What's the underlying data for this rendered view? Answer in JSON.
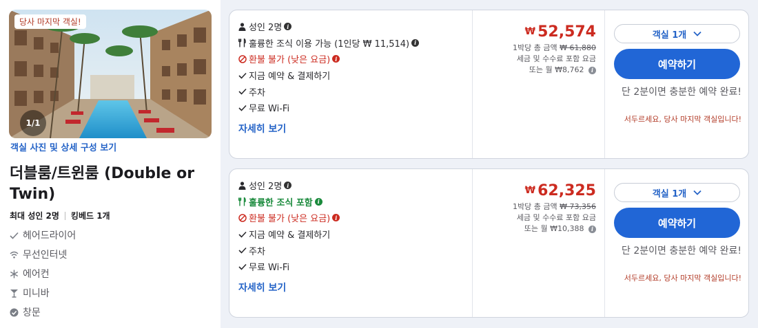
{
  "room": {
    "badge": "당사 마지막 객실!",
    "photo_counter": "1/1",
    "photo_link": "객실 사진 및 상세 구성 보기",
    "title": "더블룸/트윈룸 (Double or Twin)",
    "max_guests": "최대 성인 2명",
    "bed": "킹베드 1개",
    "amenities": [
      {
        "icon": "check-icon",
        "label": "헤어드라이어"
      },
      {
        "icon": "wifi-icon",
        "label": "무선인터넷"
      },
      {
        "icon": "snowflake-icon",
        "label": "에어컨"
      },
      {
        "icon": "cocktail-icon",
        "label": "미니바"
      },
      {
        "icon": "check-circle-icon",
        "label": "창문"
      }
    ]
  },
  "offers": [
    {
      "guests": "성인 2명",
      "breakfast": "훌륭한 조식 이용 가능 (1인당 ₩ 11,514)",
      "refund": "환불 불가 (낮은 요금)",
      "pay_now": "지금 예약 & 결제하기",
      "parking": "주차",
      "wifi": "무료 Wi-Fi",
      "details_link": "자세히 보기",
      "currency": "₩",
      "price": "52,574",
      "total_label": "1박당 총 금액",
      "total_value": "₩ 61,880",
      "tax_note": "세금 및 수수료 포함 요금",
      "monthly": "또는 월 ₩8,762",
      "room_select": "객실 1개",
      "book_label": "예약하기",
      "quick_note": "단 2분이면 충분한 예약 완료!",
      "hurry_note": "서두르세요, 당사 마지막 객실입니다!"
    },
    {
      "guests": "성인 2명",
      "breakfast": "훌륭한 조식 포함",
      "refund": "환불 불가 (낮은 요금)",
      "pay_now": "지금 예약 & 결제하기",
      "parking": "주차",
      "wifi": "무료 Wi-Fi",
      "details_link": "자세히 보기",
      "currency": "₩",
      "price": "62,325",
      "total_label": "1박당 총 금액",
      "total_value": "₩ 73,356",
      "tax_note": "세금 및 수수료 포함 요금",
      "monthly": "또는 월 ₩10,388",
      "room_select": "객실 1개",
      "book_label": "예약하기",
      "quick_note": "단 2분이면 충분한 예약 완료!",
      "hurry_note": "서두르세요, 당사 마지막 객실입니다!"
    }
  ],
  "colors": {
    "price": "#cc2b20",
    "link": "#2463c7",
    "book_button": "#2166d6",
    "breakfast_included": "#1a8a3c"
  }
}
